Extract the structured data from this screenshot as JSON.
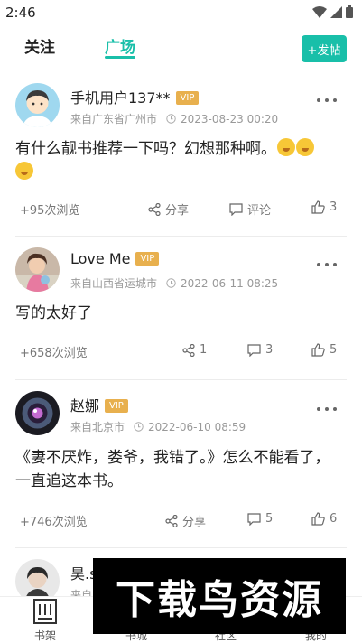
{
  "status_bar": {
    "time": "2:46",
    "icons": [
      "wifi-icon",
      "signal-icon",
      "battery-icon"
    ]
  },
  "header": {
    "tabs": [
      {
        "label": "关注",
        "active": false
      },
      {
        "label": "广场",
        "active": true
      }
    ],
    "post_button": "+发帖"
  },
  "colors": {
    "accent": "#19bfa9",
    "vip": "#e8b04e"
  },
  "posts": [
    {
      "username": "手机用户137**",
      "vip": "VIP",
      "location": "来自广东省广州市",
      "time": "2023-08-23 00:20",
      "content": "有什么靓书推荐一下吗？幻想那种啊。",
      "emoji_count": 3,
      "views": "+95次浏览",
      "share": "分享",
      "comment": "评论",
      "likes": "3"
    },
    {
      "username": "Love Me",
      "vip": "VIP",
      "location": "来自山西省运城市",
      "time": "2022-06-11 08:25",
      "content": "写的太好了",
      "views": "+658次浏览",
      "share": "1",
      "comment": "3",
      "likes": "5"
    },
    {
      "username": "赵娜",
      "vip": "VIP",
      "location": "来自北京市",
      "time": "2022-06-10 08:59",
      "content": "《妻不厌炸，娄爷，我错了。》怎么不能看了，一直追这本书。",
      "views": "+746次浏览",
      "share": "分享",
      "comment": "5",
      "likes": "6"
    },
    {
      "username": "昊.s",
      "location": "来自"
    }
  ],
  "bottom_nav": [
    {
      "label": "书架",
      "icon": "bookshelf-icon"
    },
    {
      "label": "书城",
      "icon": "bookstore-icon"
    },
    {
      "label": "社区",
      "icon": "community-icon"
    },
    {
      "label": "我的",
      "icon": "profile-icon"
    }
  ],
  "watermark": "下载鸟资源"
}
